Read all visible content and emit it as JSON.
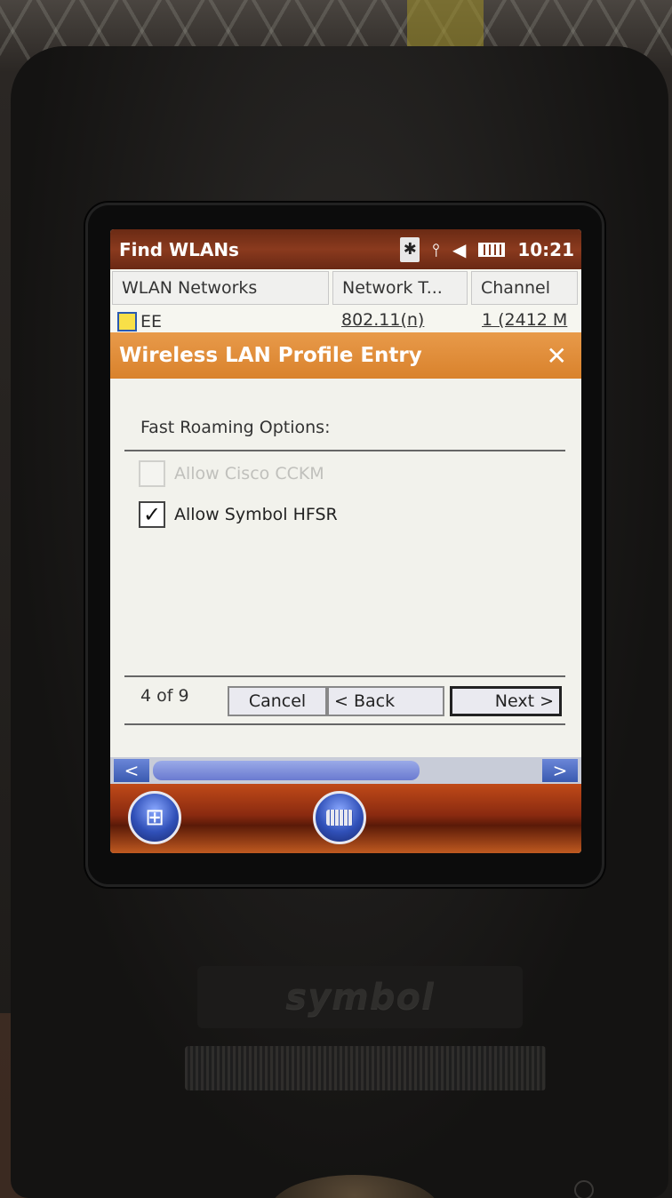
{
  "device": {
    "logo": "symbol"
  },
  "statusbar": {
    "app_title": "Find WLANs",
    "time": "10:21"
  },
  "list": {
    "columns": [
      "WLAN Networks",
      "Network T...",
      "Channel"
    ],
    "rows": [
      {
        "name": "EE",
        "type": "802.11(n)",
        "channel": "1 (2412 M"
      }
    ]
  },
  "dialog": {
    "title": "Wireless LAN Profile Entry",
    "section_label": "Fast Roaming Options:",
    "options": [
      {
        "label": "Allow Cisco CCKM",
        "checked": false,
        "enabled": false
      },
      {
        "label": "Allow Symbol HFSR",
        "checked": true,
        "enabled": true
      }
    ],
    "page_indicator": "4 of 9",
    "buttons": {
      "cancel": "Cancel",
      "back": "< Back",
      "next": "Next >"
    }
  },
  "colors": {
    "titlebar": "#7a3418",
    "dialog_header": "#e08a36",
    "screen_bg": "#f2f2ec"
  }
}
